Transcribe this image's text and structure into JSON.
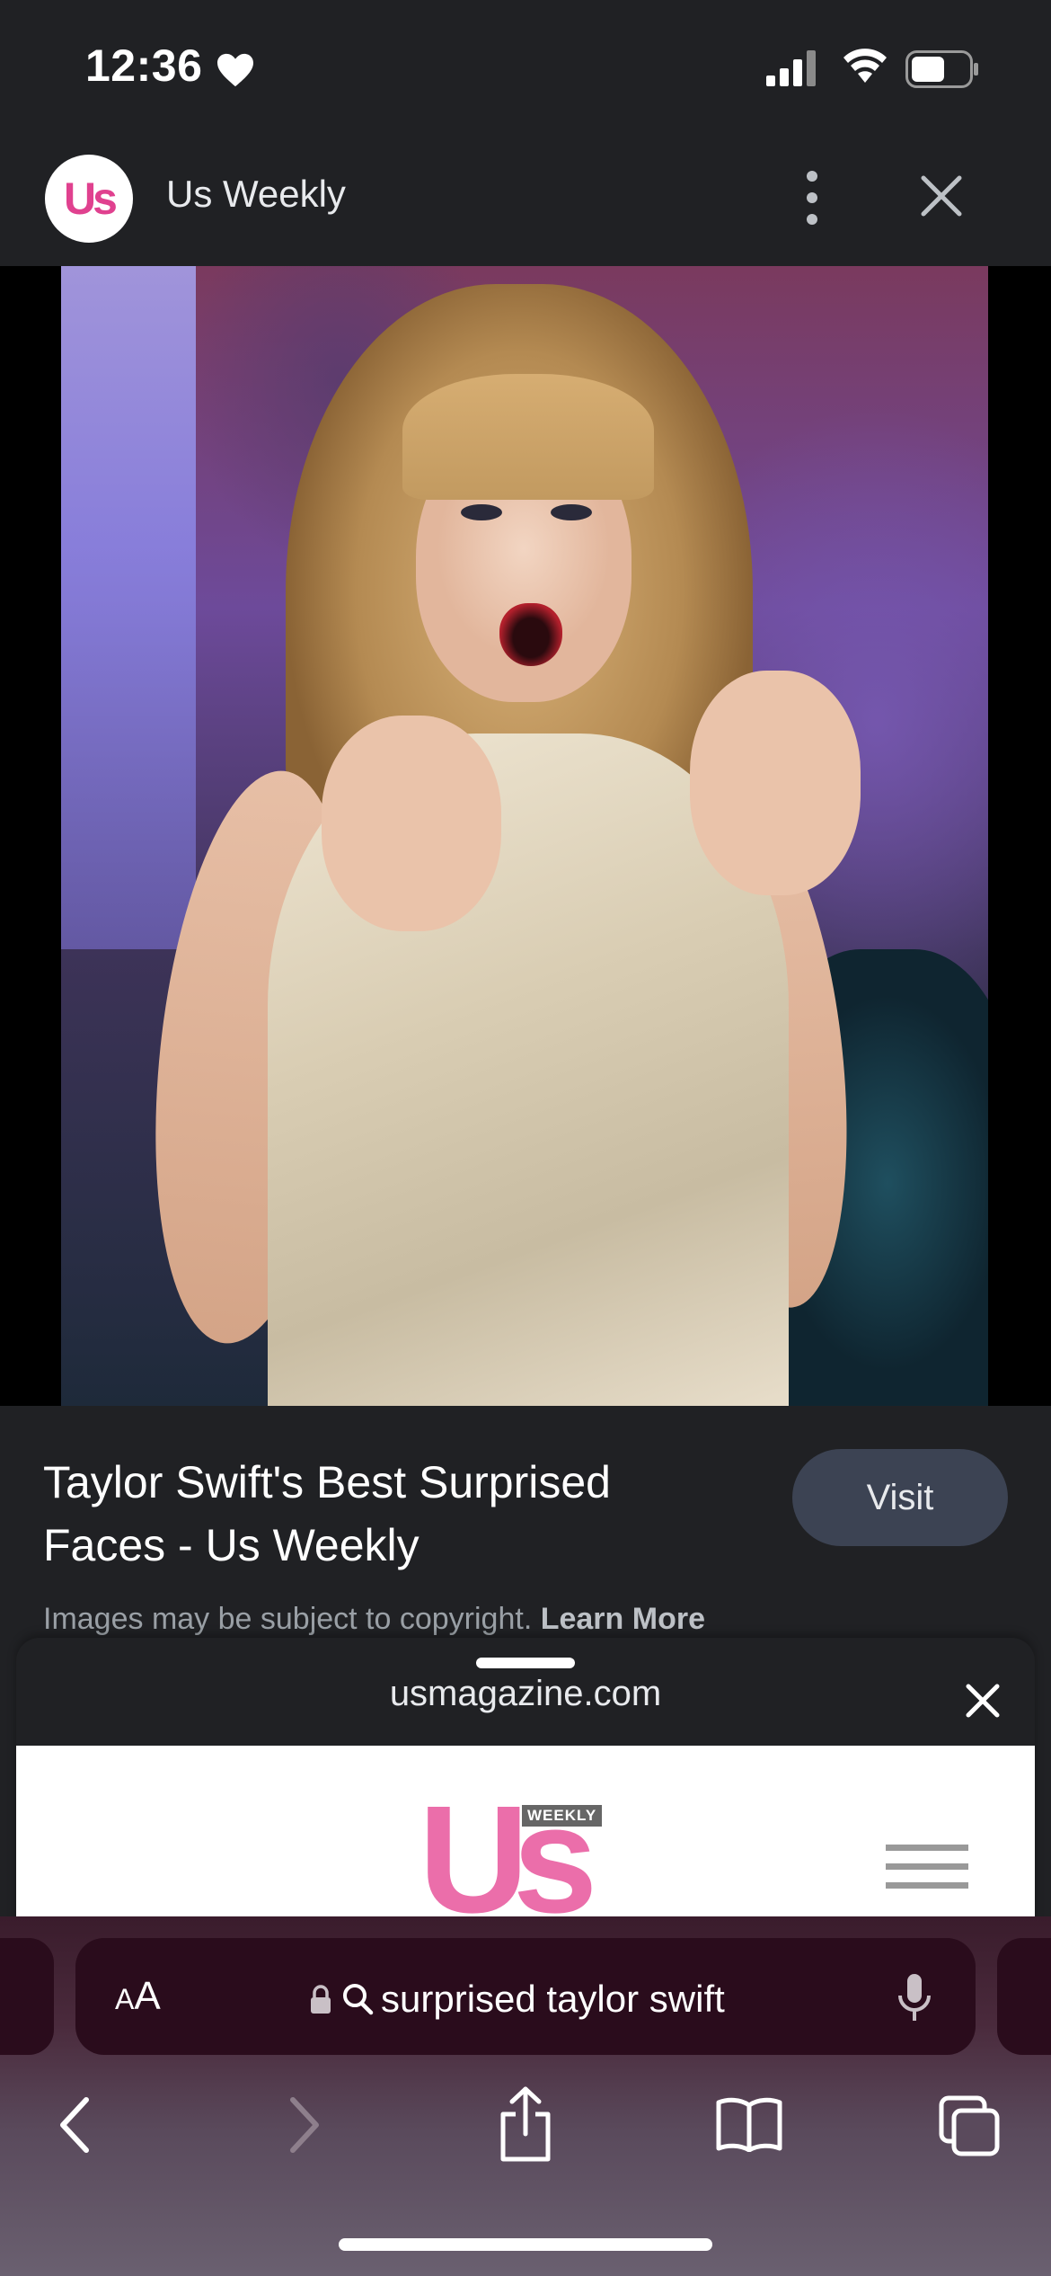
{
  "status_bar": {
    "time": "12:36",
    "heart_icon": "heart-icon",
    "signal_icon": "cellular-signal-icon",
    "wifi_icon": "wifi-icon",
    "battery_icon": "battery-icon"
  },
  "source": {
    "logo_text": "Us",
    "title": "Us Weekly",
    "more_icon": "more-vertical-icon",
    "close_icon": "close-icon"
  },
  "result": {
    "lens_icon": "google-lens-icon",
    "title": "Taylor Swift's Best Surprised Faces - Us Weekly",
    "visit_label": "Visit",
    "copyright_text": "Images may be subject to copyright.",
    "learn_more_label": "Learn More"
  },
  "sheet": {
    "domain": "usmagazine.com",
    "close_icon": "close-icon",
    "site_logo_text": "Us",
    "site_logo_badge": "WEEKLY",
    "menu_icon": "hamburger-menu-icon"
  },
  "safari": {
    "text_size_label_large": "A",
    "text_size_label_small": "A",
    "url_text": "surprised taylor swift",
    "lock_icon": "lock-icon",
    "search_icon": "search-icon",
    "mic_icon": "microphone-icon",
    "toolbar": {
      "back_icon": "back-chevron-icon",
      "forward_icon": "forward-chevron-icon",
      "share_icon": "share-icon",
      "bookmarks_icon": "bookmarks-book-icon",
      "tabs_icon": "tabs-icon"
    }
  },
  "colors": {
    "app_background": "#202124",
    "visit_button": "#3c4353",
    "brand_pink": "#e0418f"
  }
}
